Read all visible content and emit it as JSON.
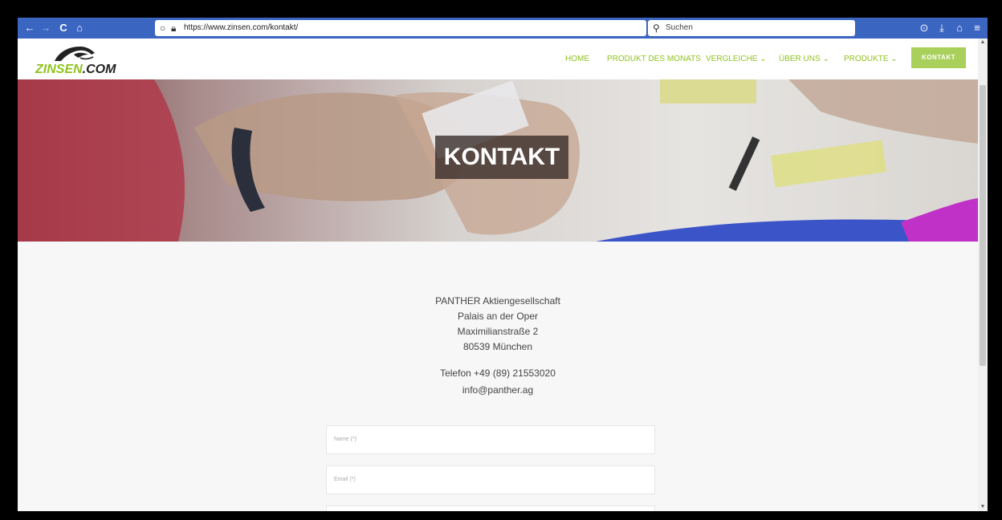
{
  "browser": {
    "url": "https://www.zinsen.com/kontakt/",
    "search_placeholder": "Suchen",
    "back_icon": "←",
    "forward_icon": "→",
    "reload_icon": "C",
    "home_icon": "⌂",
    "bookmark_icon": "☆",
    "pocket_icon": "⊙",
    "download_icon": "⤓",
    "library_icon": "⌂",
    "menu_icon": "≡"
  },
  "site": {
    "logo_text_green": "ZINSEN",
    "logo_text_black": ".COM",
    "nav": [
      {
        "label": "HOME"
      },
      {
        "label": "PRODUKT DES MONATS"
      },
      {
        "label": "VERGLEICHE ⌄"
      },
      {
        "label": "ÜBER UNS ⌄"
      },
      {
        "label": "PRODUKTE ⌄"
      }
    ],
    "contact_button": "KONTAKT"
  },
  "hero": {
    "title": "KONTAKT"
  },
  "address": {
    "company": "PANTHER Aktiengesellschaft",
    "building": "Palais an der Oper",
    "street": "Maximilianstraße 2",
    "city": "80539 München",
    "phone": "Telefon +49 (89) 21553020",
    "email": "info@panther.ag"
  },
  "form": {
    "name_placeholder": "Name (*)",
    "email_placeholder": "Email (*)"
  },
  "colors": {
    "brand_green": "#8fc31f",
    "browser_blue": "#3a65c1"
  }
}
